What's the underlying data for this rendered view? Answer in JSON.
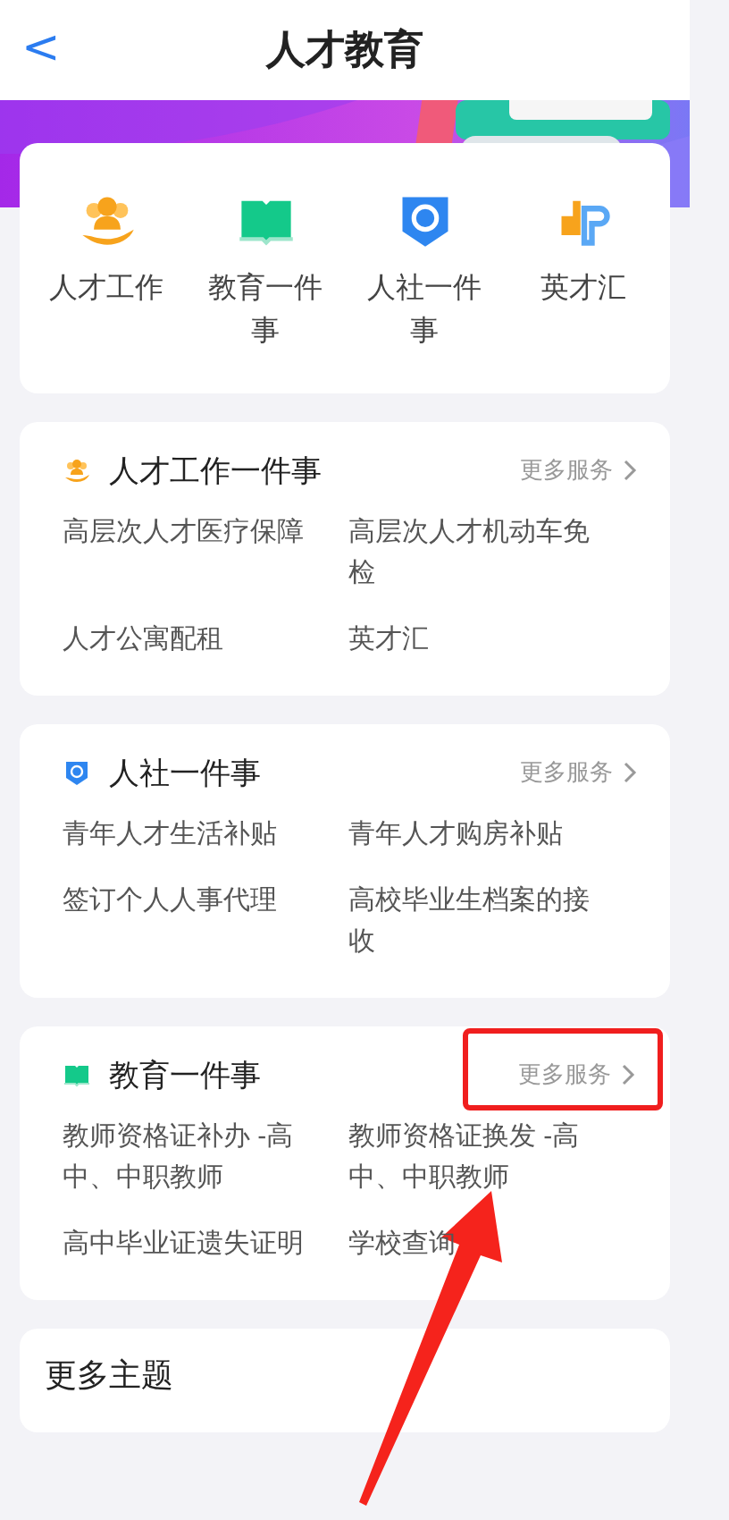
{
  "header": {
    "back": "<",
    "title": "人才教育"
  },
  "quick_links": [
    {
      "label": "人才工作",
      "kind": "people"
    },
    {
      "label": "教育一件事",
      "kind": "book"
    },
    {
      "label": "人社一件事",
      "kind": "shield"
    },
    {
      "label": "英才汇",
      "kind": "logo"
    }
  ],
  "groups": [
    {
      "title": "人才工作一件事",
      "kind": "people",
      "more": "更多服务",
      "more_highlighted": false,
      "items": [
        "高层次人才医疗保障",
        "高层次人才机动车免检",
        "人才公寓配租",
        "英才汇"
      ]
    },
    {
      "title": "人社一件事",
      "kind": "shield",
      "more": "更多服务",
      "more_highlighted": false,
      "items": [
        "青年人才生活补贴",
        "青年人才购房补贴",
        "签订个人人事代理",
        "高校毕业生档案的接收"
      ]
    },
    {
      "title": "教育一件事",
      "kind": "book",
      "more": "更多服务",
      "more_highlighted": true,
      "items": [
        "教师资格证补办 -高中、中职教师",
        "教师资格证换发 -高中、中职教师",
        "高中毕业证遗失证明",
        "学校查询"
      ]
    }
  ],
  "more_topics": {
    "title": "更多主题"
  }
}
